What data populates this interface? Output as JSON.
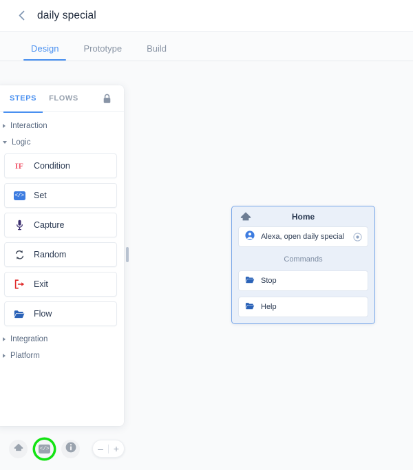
{
  "header": {
    "back_icon": "chevron-left-icon",
    "title": "daily special"
  },
  "tabs": [
    {
      "label": "Design",
      "active": true
    },
    {
      "label": "Prototype",
      "active": false
    },
    {
      "label": "Build",
      "active": false
    }
  ],
  "steps_panel": {
    "tabs": [
      {
        "label": "STEPS",
        "active": true
      },
      {
        "label": "FLOWS",
        "active": false
      }
    ],
    "lock_icon": "lock-icon",
    "categories": [
      {
        "label": "Interaction",
        "expanded": false,
        "items": []
      },
      {
        "label": "Logic",
        "expanded": true,
        "items": [
          {
            "label": "Condition",
            "icon": "if-icon",
            "color": "#f05a6e"
          },
          {
            "label": "Set",
            "icon": "code-badge-icon",
            "color": "#3d7ce0"
          },
          {
            "label": "Capture",
            "icon": "microphone-icon",
            "color": "#3b2e6e"
          },
          {
            "label": "Random",
            "icon": "shuffle-icon",
            "color": "#3b4455"
          },
          {
            "label": "Exit",
            "icon": "exit-icon",
            "color": "#e02b2b"
          },
          {
            "label": "Flow",
            "icon": "folder-icon",
            "color": "#2b63b8"
          }
        ]
      },
      {
        "label": "Integration",
        "expanded": false,
        "items": []
      },
      {
        "label": "Platform",
        "expanded": false,
        "items": []
      }
    ],
    "scrollbar": "panel-scrollbar"
  },
  "diagram": {
    "node": {
      "header_icon": "home-icon",
      "title": "Home",
      "intent": {
        "icon": "user-circle-icon",
        "label": "Alexa, open daily special",
        "port_icon": "connector-port-icon"
      },
      "section_label": "Commands",
      "commands": [
        {
          "label": "Stop",
          "icon": "folder-icon"
        },
        {
          "label": "Help",
          "icon": "folder-icon"
        }
      ]
    }
  },
  "bottom_toolbar": {
    "buttons": [
      {
        "name": "home",
        "icon": "home-icon",
        "highlighted": false
      },
      {
        "name": "variables",
        "icon": "code-badge-icon",
        "highlighted": true
      },
      {
        "name": "info",
        "icon": "info-icon",
        "highlighted": false
      }
    ],
    "zoom_out_label": "–",
    "zoom_in_label": "+"
  },
  "colors": {
    "accent_blue": "#4a90f0",
    "node_border": "#7aa7e8",
    "node_bg": "#eaf0f9",
    "highlight_green": "#13e313",
    "canvas_bg": "#f9fafb"
  }
}
